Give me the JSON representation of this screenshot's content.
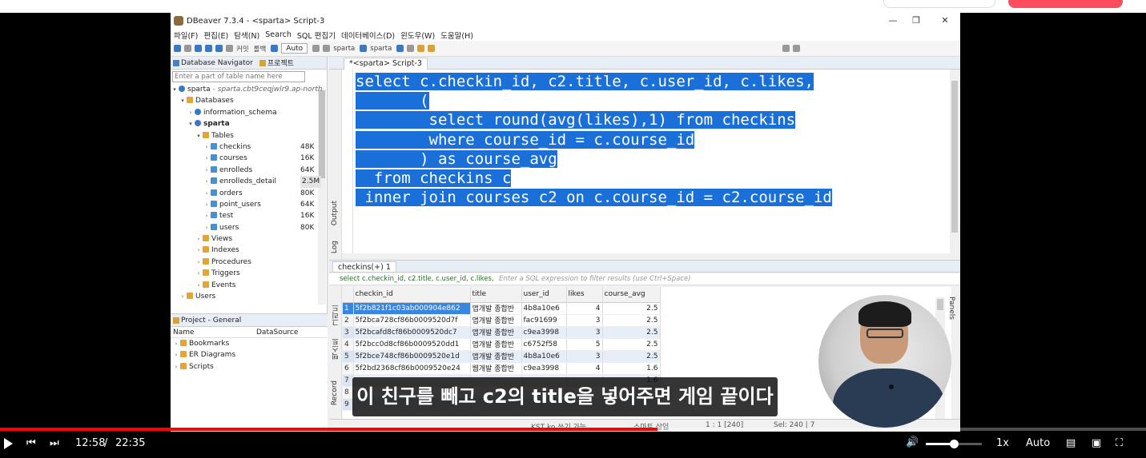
{
  "window": {
    "title": "DBeaver 7.3.4 - <sparta> Script-3",
    "menu": [
      "파일(F)",
      "편집(E)",
      "탐색(N)",
      "Search",
      "SQL 편집기",
      "데이터베이스(D)",
      "윈도우(W)",
      "도움말(H)"
    ],
    "toolbar": {
      "auto_label": "Auto",
      "datasource1": "sparta",
      "datasource2": "sparta",
      "commit": "커밋",
      "rollback": "롤백"
    }
  },
  "navigator": {
    "tab1": "Database Navigator",
    "tab2": "프로젝트",
    "filter_placeholder": "Enter a part of table name here",
    "connection": "sparta",
    "connection_host": "- sparta.cbt9ceqjwlr9.ap-north",
    "databases": "Databases",
    "schema1": "information_schema",
    "schema2": "sparta",
    "tables_folder": "Tables",
    "tables": [
      {
        "name": "checkins",
        "size": "48K"
      },
      {
        "name": "courses",
        "size": "16K"
      },
      {
        "name": "enrolleds",
        "size": "64K"
      },
      {
        "name": "enrolleds_detail",
        "size": "2.5M"
      },
      {
        "name": "orders",
        "size": "80K"
      },
      {
        "name": "point_users",
        "size": "64K"
      },
      {
        "name": "test",
        "size": "16K"
      },
      {
        "name": "users",
        "size": "80K"
      }
    ],
    "folders": [
      "Views",
      "Indexes",
      "Procedures",
      "Triggers",
      "Events"
    ],
    "users": "Users"
  },
  "project": {
    "title": "Project - General",
    "col_name": "Name",
    "col_ds": "DataSource",
    "items": [
      "Bookmarks",
      "ER Diagrams",
      "Scripts"
    ]
  },
  "editor": {
    "tab": "*<sparta> Script-3",
    "side_output": "Output",
    "side_log": "Log",
    "lines": [
      "select c.checkin_id, c2.title, c.user_id, c.likes,",
      "       (",
      "        select round(avg(likes),1) from checkins",
      "        where course_id = c.course_id",
      "       ) as course_avg",
      "  from checkins c",
      " inner join courses c2 on c.course_id = c2.course_id"
    ]
  },
  "results": {
    "tab": "checkins(+) 1",
    "filter_sql": "select c.checkin_id, c2.title, c.user_id, c.likes,",
    "filter_placeholder": "Enter a SQL expression to filter results (use Ctrl+Space)",
    "columns": [
      "checkin_id",
      "title",
      "user_id",
      "likes",
      "course_avg"
    ],
    "rows": [
      [
        "1",
        "5f2b821f1c03ab000904e862",
        "앱개발 종합반",
        "4b8a10e6",
        "4",
        "2.5"
      ],
      [
        "2",
        "5f2bca728cf86b0009520d7f",
        "앱개발 종합반",
        "fac91699",
        "3",
        "2.5"
      ],
      [
        "3",
        "5f2bcafd8cf86b0009520dc7",
        "앱개발 종합반",
        "c9ea3998",
        "3",
        "2.5"
      ],
      [
        "4",
        "5f2bcc0d8cf86b0009520dd1",
        "앱개발 종합반",
        "c6752f58",
        "5",
        "2.5"
      ],
      [
        "5",
        "5f2bce748cf86b0009520e1d",
        "앱개발 종합반",
        "4b8a10e6",
        "3",
        "2.5"
      ],
      [
        "6",
        "5f2bd2368cf86b0009520e24",
        "웹개발 종합반",
        "c9ea3998",
        "4",
        "1.6"
      ],
      [
        "7",
        "",
        "",
        "",
        "",
        "1.6"
      ],
      [
        "8",
        "",
        "",
        "",
        "",
        ""
      ],
      [
        "9",
        "",
        "",
        "",
        "",
        ""
      ]
    ],
    "side_record": "Record",
    "side_text": "텍스트",
    "side_grid": "그리드",
    "panels": "Panels"
  },
  "statusbar": {
    "left": "KST   ko   쓰기 가능",
    "insert": "스마트 삽입",
    "pos": "1 : 1 [240]",
    "sel": "Sel: 240 | 7"
  },
  "subtitle": "이 친구를 빼고 c2의 title을 넣어주면 게임 끝이다",
  "player": {
    "current_time": "12:58",
    "separator": "/",
    "duration": "22:35",
    "progress": 0.574,
    "volume": 0.5,
    "speed": "1x",
    "quality": "Auto"
  },
  "colors": {
    "selection": "#1a6fd8",
    "progress": "#ff0000"
  }
}
